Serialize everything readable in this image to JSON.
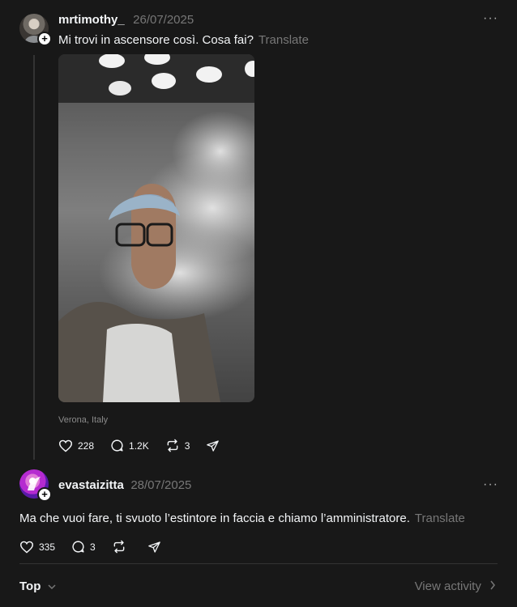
{
  "post": {
    "username": "mrtimothy_",
    "date": "26/07/2025",
    "text": "Mi trovi in ascensore così. Cosa fai?",
    "translate_label": "Translate",
    "location": "Verona, Italy",
    "likes": "228",
    "comments": "1.2K",
    "reposts": "3"
  },
  "reply": {
    "username": "evastaizitta",
    "date": "28/07/2025",
    "text": "Ma che vuoi fare, ti svuoto l’estintore in faccia e chiamo l’amministratore.",
    "translate_label": "Translate",
    "likes": "335",
    "comments": "3"
  },
  "footer": {
    "sort_label": "Top",
    "view_activity_label": "View activity"
  },
  "icons": {
    "more": "more-icon",
    "heart": "heart-icon",
    "comment": "comment-icon",
    "repost": "repost-icon",
    "share": "share-icon",
    "plus": "plus-icon",
    "chevron_down": "chevron-down-icon",
    "chevron_right": "chevron-right-icon"
  }
}
